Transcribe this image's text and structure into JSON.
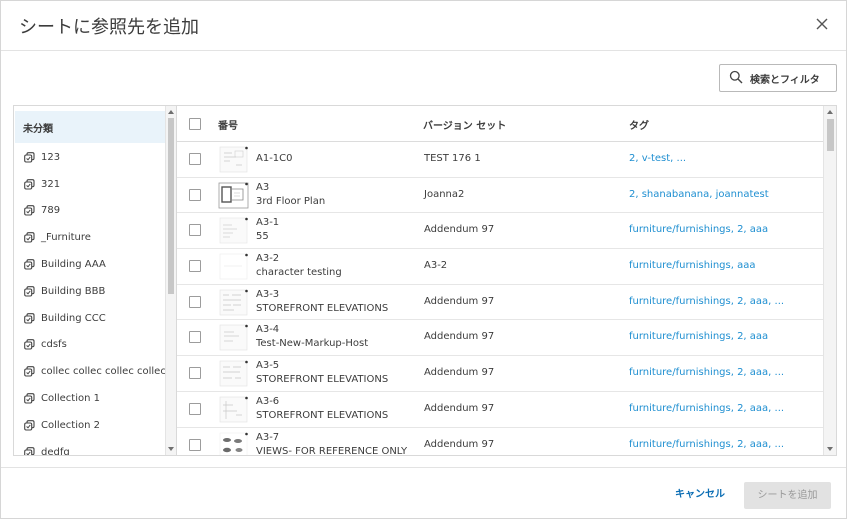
{
  "dialog": {
    "title": "シートに参照先を追加",
    "close_icon": "close-icon",
    "search_filter_label": "検索とフィルタ",
    "cancel_label": "キャンセル",
    "add_label": "シートを追加"
  },
  "sidebar": {
    "header": "未分類",
    "items": [
      {
        "label": "123"
      },
      {
        "label": "321"
      },
      {
        "label": "789"
      },
      {
        "label": "_Furniture"
      },
      {
        "label": "Building AAA"
      },
      {
        "label": "Building BBB"
      },
      {
        "label": "Building CCC"
      },
      {
        "label": "cdsfs"
      },
      {
        "label": "collec collec collec collec"
      },
      {
        "label": "Collection 1"
      },
      {
        "label": "Collection 2"
      },
      {
        "label": "dedfg"
      }
    ]
  },
  "table": {
    "headers": {
      "number": "番号",
      "version_set": "バージョン セット",
      "tags": "タグ"
    },
    "rows": [
      {
        "number": "A1-1C0",
        "title": "",
        "version_set": "TEST 176 1",
        "tags": "2, v-test, ..."
      },
      {
        "number": "A3",
        "title": "3rd Floor Plan",
        "version_set": "Joanna2",
        "tags": "2, shanabanana, joannatest"
      },
      {
        "number": "A3-1",
        "title": "55",
        "version_set": "Addendum 97",
        "tags": "furniture/furnishings, 2, aaa"
      },
      {
        "number": "A3-2",
        "title": "character testing",
        "version_set": "A3-2",
        "tags": "furniture/furnishings, aaa"
      },
      {
        "number": "A3-3",
        "title": "STOREFRONT ELEVATIONS",
        "version_set": "Addendum 97",
        "tags": "furniture/furnishings, 2, aaa, ..."
      },
      {
        "number": "A3-4",
        "title": "Test-New-Markup-Host",
        "version_set": "Addendum 97",
        "tags": "furniture/furnishings, 2, aaa"
      },
      {
        "number": "A3-5",
        "title": "STOREFRONT ELEVATIONS",
        "version_set": "Addendum 97",
        "tags": "furniture/furnishings, 2, aaa, ..."
      },
      {
        "number": "A3-6",
        "title": "STOREFRONT ELEVATIONS",
        "version_set": "Addendum 97",
        "tags": "furniture/furnishings, 2, aaa, ..."
      },
      {
        "number": "A3-7",
        "title": "VIEWS- FOR REFERENCE ONLY",
        "version_set": "Addendum 97",
        "tags": "furniture/furnishings, 2, aaa, ..."
      }
    ]
  },
  "colors": {
    "accent": "#0b6db4",
    "tag_link": "#1f8fd1",
    "selected_bg": "#e9f3fa"
  }
}
